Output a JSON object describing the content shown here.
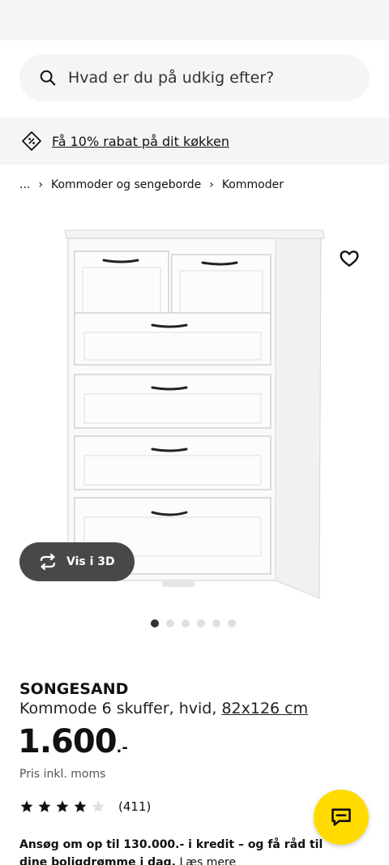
{
  "search": {
    "placeholder": "Hvad er du på udkig efter?"
  },
  "promo": {
    "text": "Få 10% rabat på dit køkken"
  },
  "breadcrumb": {
    "ellipsis": "...",
    "items": [
      "Kommoder og sengeborde",
      "Kommoder"
    ]
  },
  "gallery": {
    "button_3d": "Vis i 3D",
    "dots_total": 6,
    "active_dot": 0
  },
  "product": {
    "name": "SONGESAND",
    "description": "Kommode 6 skuffer, hvid,",
    "dimensions": "82x126 cm",
    "price": "1.600",
    "price_suffix": ".-",
    "price_note": "Pris inkl. moms",
    "rating": 4,
    "rating_max": 5,
    "reviews": "(411)"
  },
  "credit": {
    "bold": "Ansøg om op til 130.000.- i kredit – og få råd til dine boligdrømme i dag.",
    "link": "Læs mere"
  },
  "colors": {
    "accent": "#ffdb00",
    "button_3d": "#484848",
    "surface": "#f5f5f5"
  }
}
